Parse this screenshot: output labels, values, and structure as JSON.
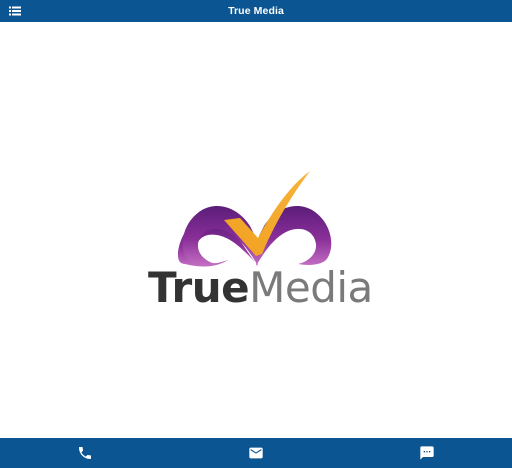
{
  "header": {
    "title": "True Media",
    "menu_icon": "list-menu-icon"
  },
  "logo": {
    "word_bold": "True",
    "word_light": "Media",
    "colors": {
      "check": "#f5a623",
      "m_purple": "#7b2a8e",
      "true_text": "#333333",
      "media_text": "#7a7a7a"
    }
  },
  "bottom_nav": {
    "items": [
      {
        "icon": "phone-icon"
      },
      {
        "icon": "mail-icon"
      },
      {
        "icon": "chat-icon"
      }
    ]
  },
  "colors": {
    "bar": "#0a5592",
    "background": "#ffffff"
  }
}
